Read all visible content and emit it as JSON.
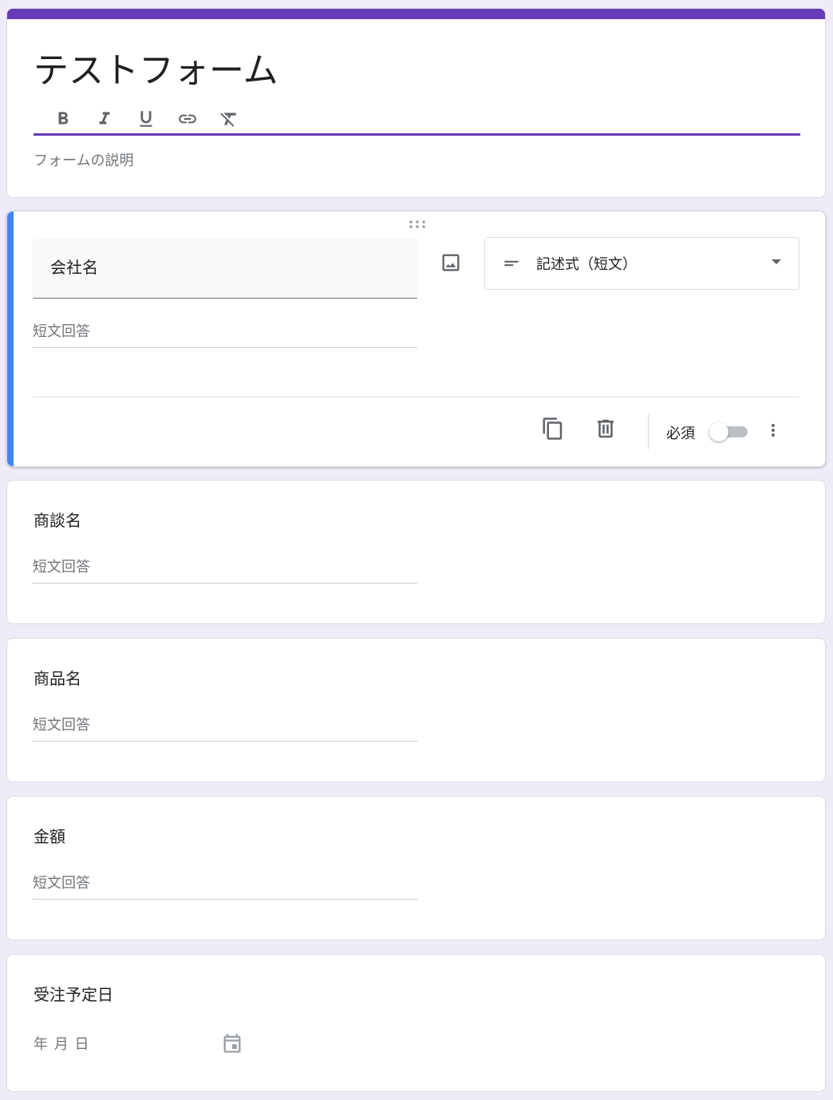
{
  "form": {
    "title": "テストフォーム",
    "description_placeholder": "フォームの説明",
    "accent_color": "#673ab7",
    "format_toolbar": [
      "bold-icon",
      "italic-icon",
      "underline-icon",
      "link-icon",
      "clear-format-icon"
    ]
  },
  "active_question": {
    "title": "会社名",
    "type_label": "記述式（短文）",
    "answer_placeholder": "短文回答",
    "required_label": "必須",
    "required": false,
    "accent_color": "#4285f4"
  },
  "questions": [
    {
      "title": "商談名",
      "answer_placeholder": "短文回答"
    },
    {
      "title": "商品名",
      "answer_placeholder": "短文回答"
    },
    {
      "title": "金額",
      "answer_placeholder": "短文回答"
    },
    {
      "title": "受注予定日",
      "date_placeholder": "年 月 日"
    }
  ]
}
